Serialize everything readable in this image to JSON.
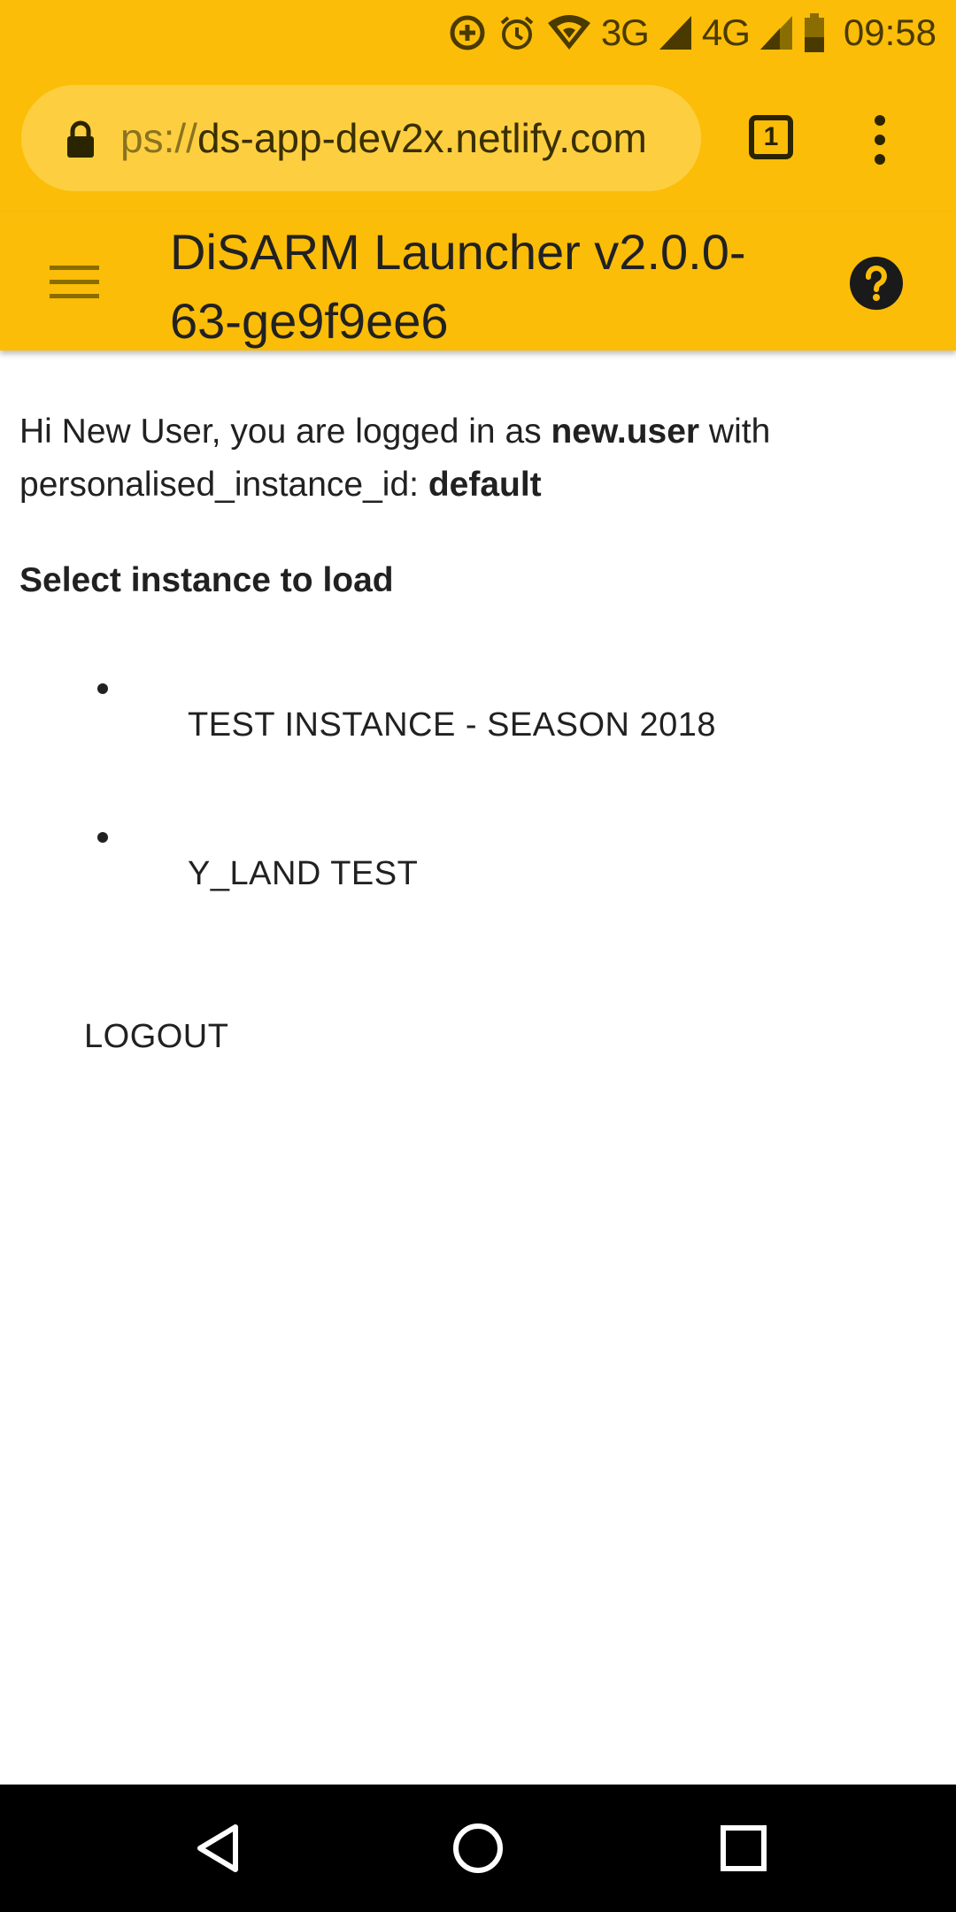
{
  "status_bar": {
    "network_1": "3G",
    "network_2": "4G",
    "time": "09:58",
    "icons": [
      "data-saver-icon",
      "alarm-icon",
      "wifi-icon",
      "signal-icon",
      "signal-icon",
      "battery-icon"
    ],
    "background_color": "#fbbd08"
  },
  "browser": {
    "url_scheme_visible": "ps://",
    "url_host": "ds-app-dev2x.netlify.com",
    "tab_count": "1"
  },
  "header": {
    "title": "DiSARM Launcher v2.0.0-63-ge9f9ee6"
  },
  "content": {
    "greeting_prefix": "Hi New User, you are logged in as ",
    "username": "new.user",
    "greeting_mid": " with personalised_instance_id: ",
    "instance_id": "default",
    "section_title": "Select instance to load",
    "instances": [
      {
        "label": "TEST INSTANCE - SEASON 2018"
      },
      {
        "label": "Y_LAND TEST"
      }
    ],
    "logout_label": "LOGOUT"
  },
  "navigation": {
    "icons": [
      "back-icon",
      "home-icon",
      "recents-icon"
    ]
  }
}
